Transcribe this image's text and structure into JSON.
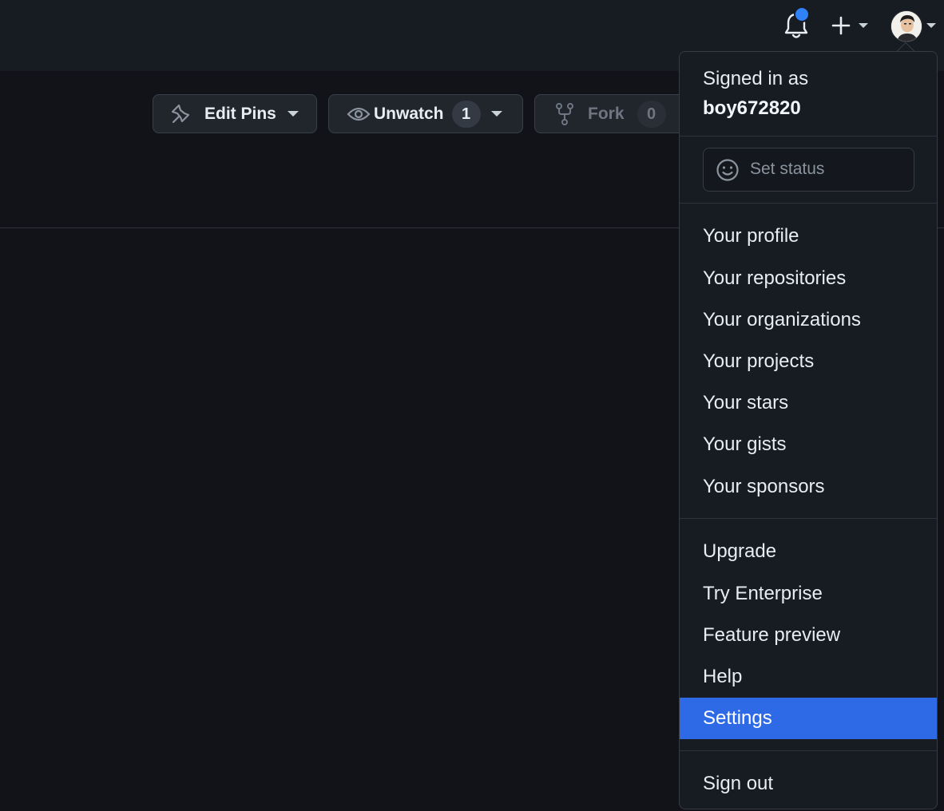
{
  "header": {
    "notifications_icon": "bell-icon",
    "create_icon": "plus-icon",
    "avatar_icon": "avatar"
  },
  "repo_actions": {
    "edit_pins": "Edit Pins",
    "unwatch": "Unwatch",
    "unwatch_count": "1",
    "fork": "Fork",
    "fork_count": "0"
  },
  "dropdown": {
    "signed_in_as": "Signed in as",
    "username": "boy672820",
    "set_status": "Set status",
    "group1": [
      "Your profile",
      "Your repositories",
      "Your organizations",
      "Your projects",
      "Your stars",
      "Your gists",
      "Your sponsors"
    ],
    "group2": [
      "Upgrade",
      "Try Enterprise",
      "Feature preview",
      "Help",
      "Settings"
    ],
    "sign_out": "Sign out",
    "active_item": "Settings"
  },
  "colors": {
    "accent": "#2f81f7",
    "highlight": "#2f6ae6",
    "background": "#111318"
  }
}
